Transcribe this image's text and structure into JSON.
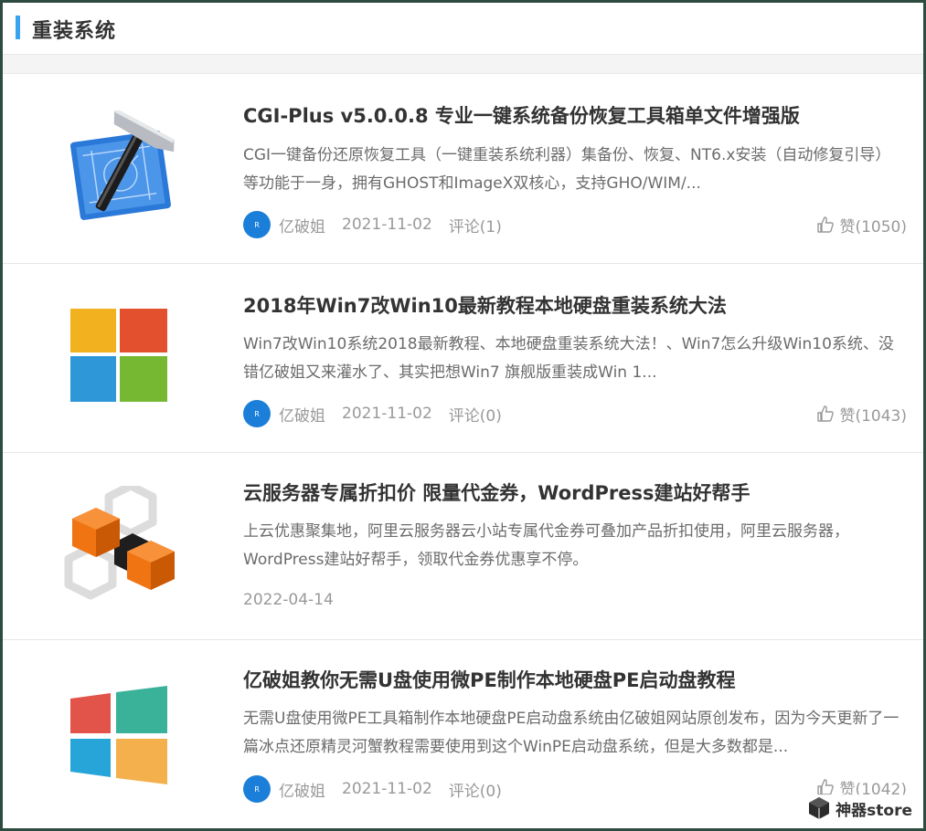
{
  "section": {
    "title": "重装系统"
  },
  "items": [
    {
      "title": "CGI-Plus v5.0.0.8 专业一键系统备份恢复工具箱单文件增强版",
      "desc": "CGI一键备份还原恢复工具（一键重装系统利器）集备份、恢复、NT6.x安装（自动修复引导）等功能于一身，拥有GHOST和ImageX双核心，支持GHO/WIM/...",
      "avatar": "R",
      "author": "亿破姐",
      "date": "2021-11-02",
      "comments": "评论(1)",
      "likes": "赞(1050)",
      "thumb_icon": "hammer-blueprint-icon"
    },
    {
      "title": "2018年Win7改Win10最新教程本地硬盘重装系统大法",
      "desc": "Win7改Win10系统2018最新教程、本地硬盘重装系统大法！、Win7怎么升级Win10系统、没错亿破姐又来灌水了、其实把想Win7 旗舰版重装成Win 1...",
      "avatar": "R",
      "author": "亿破姐",
      "date": "2021-11-02",
      "comments": "评论(0)",
      "likes": "赞(1043)",
      "thumb_icon": "windows-flag-icon"
    },
    {
      "title": "云服务器专属折扣价 限量代金券，WordPress建站好帮手",
      "desc": "上云优惠聚集地，阿里云服务器云小站专属代金券可叠加产品折扣使用，阿里云服务器，WordPress建站好帮手，领取代金券优惠享不停。",
      "date": "2022-04-14",
      "thumb_icon": "cube-blocks-icon"
    },
    {
      "title": "亿破姐教你无需U盘使用微PE制作本地硬盘PE启动盘教程",
      "desc": "无需U盘使用微PE工具箱制作本地硬盘PE启动盘系统由亿破姐网站原创发布，因为今天更新了一篇冰点还原精灵河蟹教程需要使用到这个WinPE启动盘系统，但是大多数都是...",
      "avatar": "R",
      "author": "亿破姐",
      "date": "2021-11-02",
      "comments": "评论(0)",
      "likes": "赞(1042)",
      "thumb_icon": "windows-logo-icon"
    }
  ],
  "watermark": {
    "text": "神器store",
    "icon": "cube-logo-icon"
  },
  "colors": {
    "accent": "#39a3f2",
    "avatar": "#1b7fd9",
    "frame": "#2e4b3f"
  }
}
